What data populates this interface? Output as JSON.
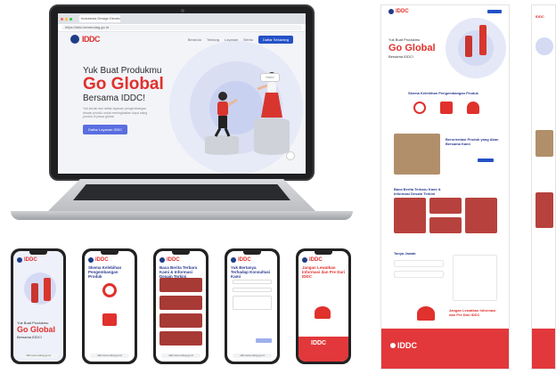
{
  "laptop": {
    "tab_title": "Indonesia Design Development Center",
    "url": "https://iddc.kemendag.go.id",
    "nav": {
      "logo_text": "IDDC",
      "links": [
        "Beranda",
        "Tentang",
        "Layanan",
        "Berita"
      ],
      "cta": "Daftar Sekarang"
    },
    "hero": {
      "line1": "Yuk Buat Produkmu",
      "line2": "Go Global",
      "line3": "Bersama IDDC!",
      "description": "Yuk kenali dan daftar layanan pengembangan desain produk untuk meningkatkan daya saing produk di pasar global.",
      "button": "Daftar Layanan IDDC",
      "speech": "Halo!"
    }
  },
  "phones": [
    {
      "title": "Yuk Buat Produkmu Go Global Bersama IDDC!",
      "url": "iddc.kemendag.go.id"
    },
    {
      "title": "Skema Kelebihan Pengembangan Produk",
      "url": "iddc.kemendag.go.id"
    },
    {
      "title": "Baca Berita Terbaru Kami & Informasi Desain Terkini",
      "url": "iddc.kemendag.go.id"
    },
    {
      "title": "Yuk Bertanya Terhadap Konsultasi Kami",
      "url": "iddc.kemendag.go.id"
    },
    {
      "title": "Jangan Lewatkan Informasi dan Pre Dari IDDC",
      "url": "iddc.kemendag.go.id"
    }
  ],
  "long_page": {
    "hero": {
      "line1": "Yuk Buat Produkmu",
      "line2": "Go Global",
      "line3": "Bersama IDDC!"
    },
    "sections": [
      "Skema Kelebihan Pengembangan Produk",
      "Berorientasi Produk yang Akan Bersama Kami",
      "Baca Berita Terbaru Kami & Informasi Desain Terkini",
      "Tanya Jawab",
      "Jangan Lewatkan Informasi dan Pre Dari IDDC"
    ]
  },
  "colors": {
    "brand_red": "#e0312d",
    "brand_blue": "#2451c7",
    "navy": "#2b3a8f"
  }
}
